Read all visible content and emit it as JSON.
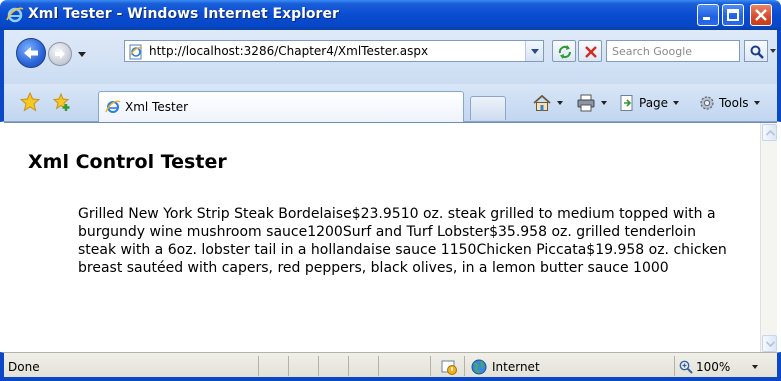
{
  "window": {
    "title": "Xml Tester - Windows Internet Explorer"
  },
  "address": {
    "url": "http://localhost:3286/Chapter4/XmlTester.aspx"
  },
  "search": {
    "placeholder": "Search Google"
  },
  "tabs": [
    {
      "label": "Xml Tester"
    }
  ],
  "commands": {
    "page_label": "Page",
    "tools_label": "Tools"
  },
  "page": {
    "heading": "Xml Control Tester",
    "body": "Grilled New York Strip Steak Bordelaise$23.9510 oz. steak grilled to medium topped with a burgundy wine mushroom sauce1200Surf and Turf Lobster$35.958 oz. grilled tenderloin steak with a 6oz. lobster tail in a hollandaise sauce 1150Chicken Piccata$19.958 oz. chicken breast sautéed with capers, red peppers, black olives, in a lemon butter sauce 1000"
  },
  "status": {
    "text": "Done",
    "zone": "Internet",
    "zoom": "100%"
  },
  "colors": {
    "titlebar": "#0a48c8",
    "frame": "#0a48c8"
  }
}
